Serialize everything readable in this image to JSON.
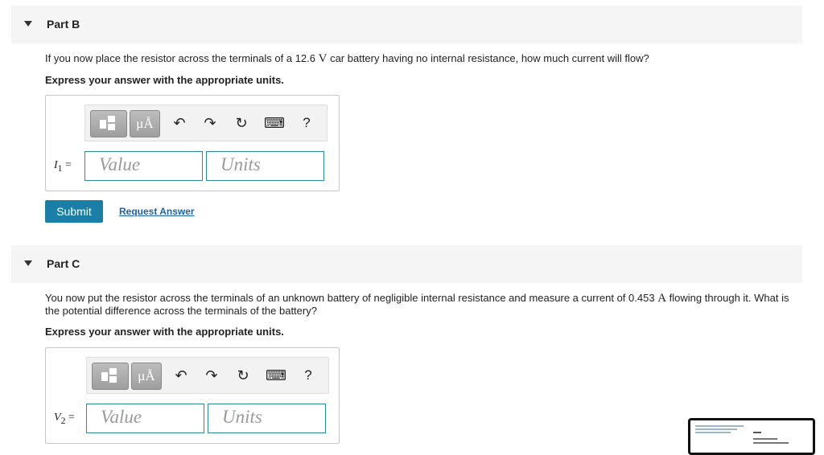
{
  "partB": {
    "title": "Part B",
    "question_pre": "If you now place the resistor across the terminals of a 12.6 ",
    "question_unit": "V",
    "question_post": " car battery having no internal resistance, how much current will flow?",
    "instruction": "Express your answer with the appropriate units.",
    "var_symbol": "I",
    "var_sub": "1",
    "var_eq": " =",
    "value_placeholder": "Value",
    "units_placeholder": "Units",
    "submit_label": "Submit",
    "request_label": "Request Answer"
  },
  "partC": {
    "title": "Part C",
    "question_pre": "You now put the resistor across the terminals of an unknown battery of negligible internal resistance and measure a current of 0.453 ",
    "question_unit": "A",
    "question_post": " flowing through it. What is the potential difference across the terminals of the battery?",
    "instruction": "Express your answer with the appropriate units.",
    "var_symbol": "V",
    "var_sub": "2",
    "var_eq": " =",
    "value_placeholder": "Value",
    "units_placeholder": "Units"
  },
  "toolbar": {
    "units_label": "μÅ",
    "undo_glyph": "↶",
    "redo_glyph": "↷",
    "reset_glyph": "↻",
    "keyboard_glyph": "⌨",
    "help_glyph": "?"
  },
  "icons": [
    "caret-down-icon",
    "templates-icon",
    "units-icon",
    "undo-icon",
    "redo-icon",
    "reset-icon",
    "keyboard-icon",
    "help-icon"
  ],
  "colors": {
    "accent": "#1a7fa6",
    "link": "#1a63a5",
    "input_border": "#2a8a9c",
    "header_bg": "#f5f5f5"
  }
}
